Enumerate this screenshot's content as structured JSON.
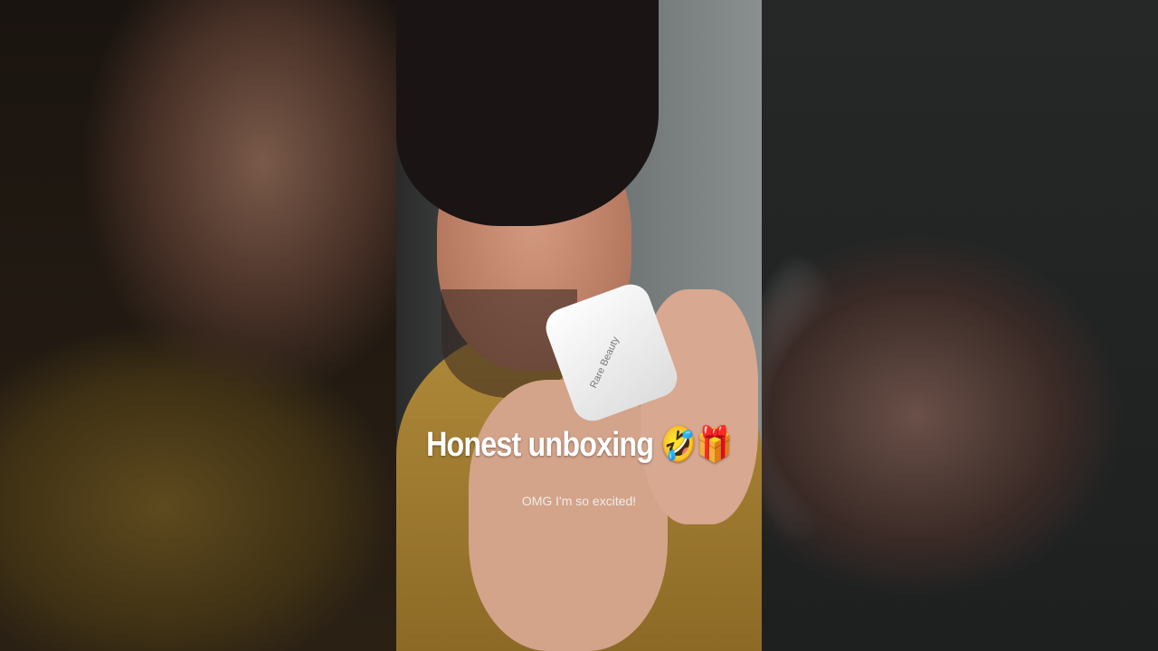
{
  "video": {
    "caption_title": "Honest unboxing 🤣🎁",
    "caption_subtitle": "OMG I'm so excited!",
    "product_brand": "Rare Beauty"
  }
}
